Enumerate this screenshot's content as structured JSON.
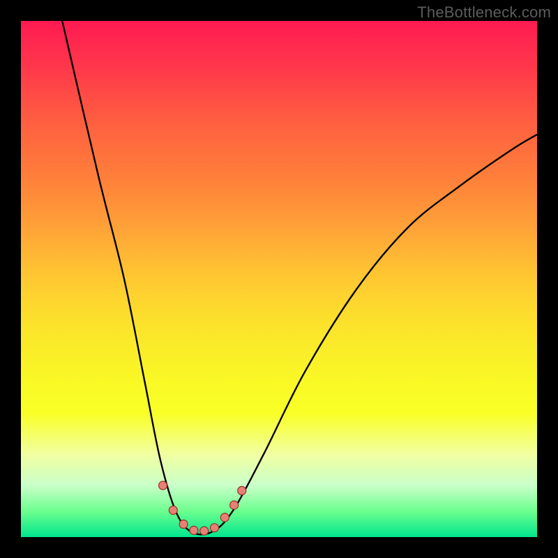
{
  "watermark": "TheBottleneck.com",
  "chart_data": {
    "type": "line",
    "title": "",
    "xlabel": "",
    "ylabel": "",
    "xlim": [
      0,
      100
    ],
    "ylim": [
      0,
      100
    ],
    "gradient_legend_implied": "top=high bottleneck (red), bottom=low bottleneck (green)",
    "series": [
      {
        "name": "bottleneck-curve",
        "points": [
          {
            "x": 8,
            "y": 100
          },
          {
            "x": 15,
            "y": 70
          },
          {
            "x": 20,
            "y": 50
          },
          {
            "x": 24,
            "y": 30
          },
          {
            "x": 27,
            "y": 15
          },
          {
            "x": 30,
            "y": 5
          },
          {
            "x": 33,
            "y": 1
          },
          {
            "x": 37,
            "y": 1
          },
          {
            "x": 41,
            "y": 5
          },
          {
            "x": 47,
            "y": 16
          },
          {
            "x": 55,
            "y": 32
          },
          {
            "x": 65,
            "y": 48
          },
          {
            "x": 75,
            "y": 60
          },
          {
            "x": 85,
            "y": 68
          },
          {
            "x": 95,
            "y": 75
          },
          {
            "x": 100,
            "y": 78
          }
        ]
      }
    ],
    "markers": [
      {
        "x": 27.5,
        "y": 10,
        "r": 6
      },
      {
        "x": 29.5,
        "y": 5.2,
        "r": 6
      },
      {
        "x": 31.5,
        "y": 2.5,
        "r": 6
      },
      {
        "x": 33.5,
        "y": 1.3,
        "r": 6
      },
      {
        "x": 35.5,
        "y": 1.2,
        "r": 6
      },
      {
        "x": 37.5,
        "y": 1.8,
        "r": 6
      },
      {
        "x": 39.5,
        "y": 3.8,
        "r": 6
      },
      {
        "x": 41.3,
        "y": 6.2,
        "r": 6
      },
      {
        "x": 42.8,
        "y": 9.0,
        "r": 6
      }
    ],
    "colors": {
      "curve": "#000000",
      "marker_fill": "#e88076",
      "marker_stroke": "#9a2e22"
    }
  }
}
